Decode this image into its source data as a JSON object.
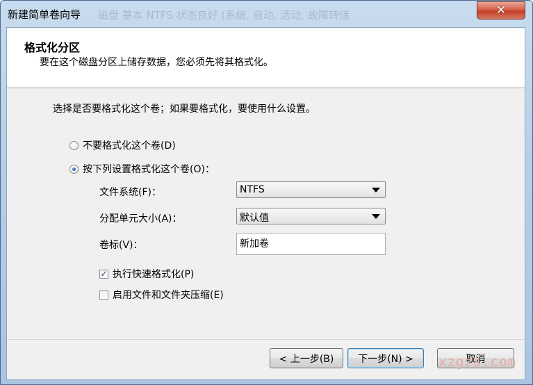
{
  "window": {
    "title": "新建简单卷向导",
    "background_title_ghost": "磁盘 基本 NTFS 状态良好 (系统, 启动, 活动, 故障转储"
  },
  "header": {
    "title": "格式化分区",
    "subtitle": "要在这个磁盘分区上储存数据，您必须先将其格式化。"
  },
  "content": {
    "question": "选择是否要格式化这个卷；如果要格式化，要使用什么设置。",
    "options": [
      {
        "label": "不要格式化这个卷(D)",
        "selected": false
      },
      {
        "label": "按下列设置格式化这个卷(O)：",
        "selected": true
      }
    ],
    "fields": {
      "filesystem": {
        "label": "文件系统(F)：",
        "value": "NTFS"
      },
      "allocation": {
        "label": "分配单元大小(A)：",
        "value": "默认值"
      },
      "volume_label": {
        "label": "卷标(V)：",
        "value": "新加卷"
      }
    },
    "checks": [
      {
        "label": "执行快速格式化(P)",
        "checked": true,
        "mark": "✓"
      },
      {
        "label": "启用文件和文件夹压缩(E)",
        "checked": false,
        "mark": ""
      }
    ]
  },
  "buttons": {
    "back": "< 上一步(B)",
    "next": "下一步(N) >",
    "cancel": "取消"
  },
  "watermark": "xzgzs.com",
  "colors": {
    "accent": "#1c4f95",
    "close": "#c24127"
  }
}
